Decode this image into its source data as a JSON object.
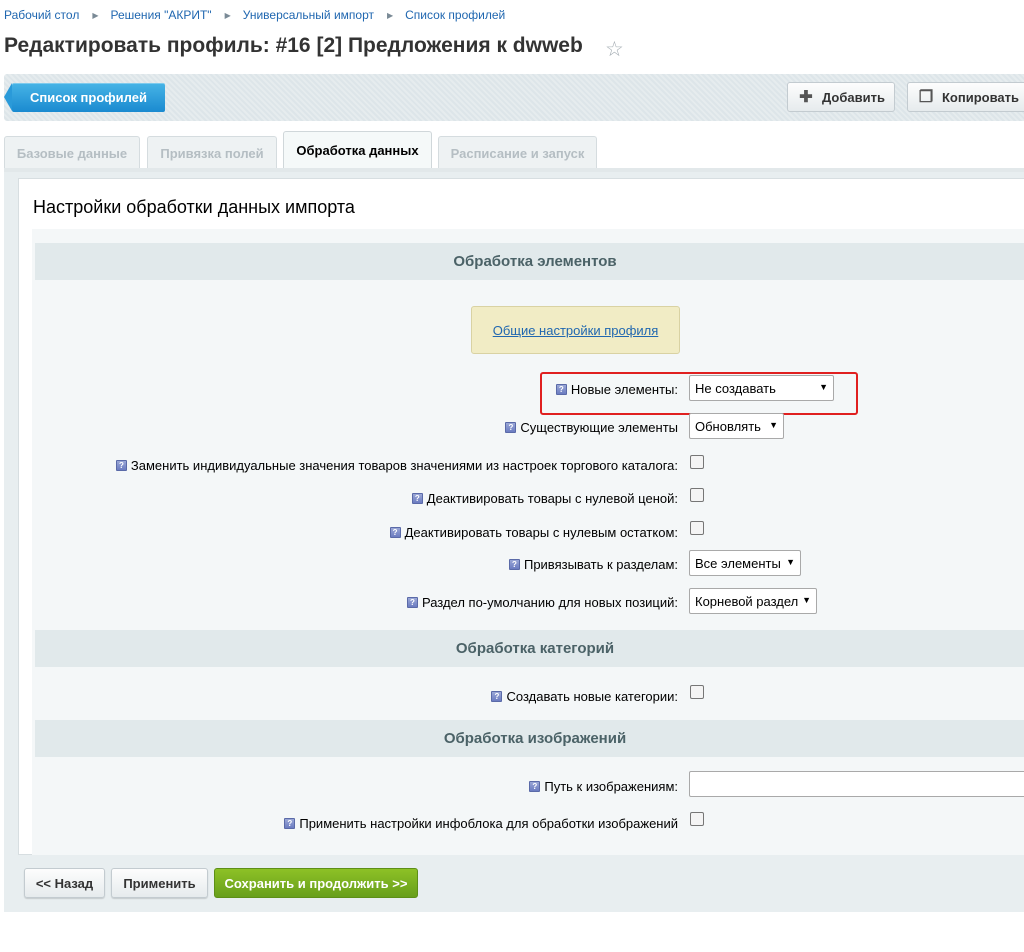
{
  "breadcrumb": [
    "Рабочий стол",
    "Решения \"АКРИТ\"",
    "Универсальный импорт",
    "Список профилей"
  ],
  "breadcrumb_separator": "▶",
  "page_title": "Редактировать профиль: #16 [2] Предложения к dwweb",
  "toolbar": {
    "list_label": "Список профилей",
    "add_label": "Добавить",
    "copy_label": "Копировать"
  },
  "tabs": [
    {
      "label": "Базовые данные",
      "active": false
    },
    {
      "label": "Привязка полей",
      "active": false
    },
    {
      "label": "Обработка данных",
      "active": true
    },
    {
      "label": "Расписание и запуск",
      "active": false
    }
  ],
  "panel_title": "Настройки обработки данных импорта",
  "sections": {
    "elements": "Обработка элементов",
    "categories": "Обработка категорий",
    "images": "Обработка изображений"
  },
  "profile_link": "Общие настройки профиля",
  "fields": {
    "new_elements": {
      "label": "Новые элементы:",
      "value": "Не создавать"
    },
    "existing_elements": {
      "label": "Существующие элементы",
      "value": "Обновлять"
    },
    "replace_values": {
      "label": "Заменить индивидуальные значения товаров значениями из настроек торгового каталога:",
      "checked": false
    },
    "deactivate_zero_price": {
      "label": "Деактивировать товары с нулевой ценой:",
      "checked": false
    },
    "deactivate_zero_stock": {
      "label": "Деактивировать товары с нулевым остатком:",
      "checked": false
    },
    "bind_sections": {
      "label": "Привязывать к разделам:",
      "value": "Все элементы"
    },
    "default_section": {
      "label": "Раздел по-умолчанию для новых позиций:",
      "value": "Корневой раздел"
    },
    "create_categories": {
      "label": "Создавать новые категории:",
      "checked": false
    },
    "images_path": {
      "label": "Путь к изображениям:",
      "value": ""
    },
    "apply_iblock_settings": {
      "label": "Применить настройки инфоблока для обработки изображений",
      "checked": false
    }
  },
  "footer": {
    "back_label": "<< Назад",
    "apply_label": "Применить",
    "save_label": "Сохранить и продолжить >>"
  },
  "colors": {
    "accent": "#1a8ad0",
    "save": "#7bb020",
    "highlight": "#e02020"
  }
}
